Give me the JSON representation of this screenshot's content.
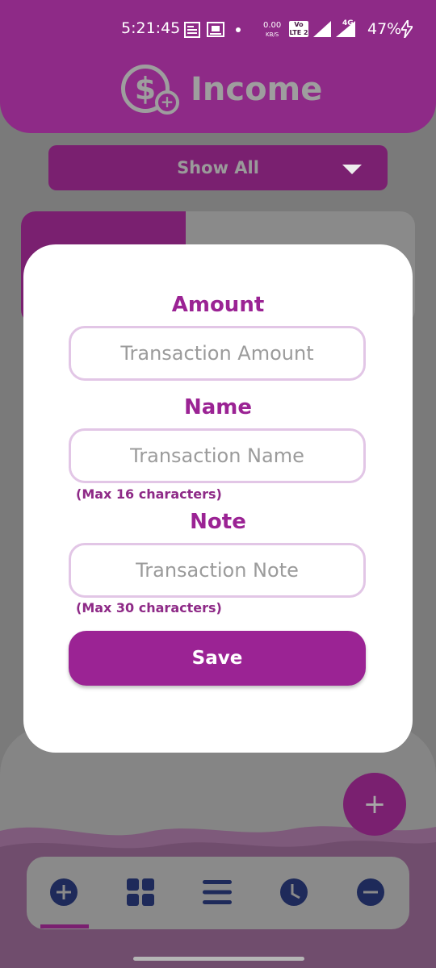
{
  "status_bar": {
    "time": "5:21:45",
    "net_speed": "0.00",
    "net_unit": "KB/S",
    "volte": "Vo LTE 2",
    "net_type": "4G",
    "battery": "47%"
  },
  "header": {
    "title": "Income"
  },
  "filter": {
    "selected": "Show All"
  },
  "dialog": {
    "amount_label": "Amount",
    "amount_placeholder": "Transaction Amount",
    "name_label": "Name",
    "name_placeholder": "Transaction Name",
    "name_hint": "(Max 16 characters)",
    "note_label": "Note",
    "note_placeholder": "Transaction Note",
    "note_hint": "(Max 30 characters)",
    "save_label": "Save"
  },
  "fab": {
    "icon": "plus-icon"
  },
  "bottom_nav": {
    "items": [
      "add-circle-icon",
      "grid-icon",
      "menu-icon",
      "clock-icon",
      "minus-circle-icon"
    ],
    "active_index": 0
  },
  "colors": {
    "primary": "#9b2394",
    "field_border": "#e2c6e6",
    "nav_icon": "#1e2a5a"
  }
}
